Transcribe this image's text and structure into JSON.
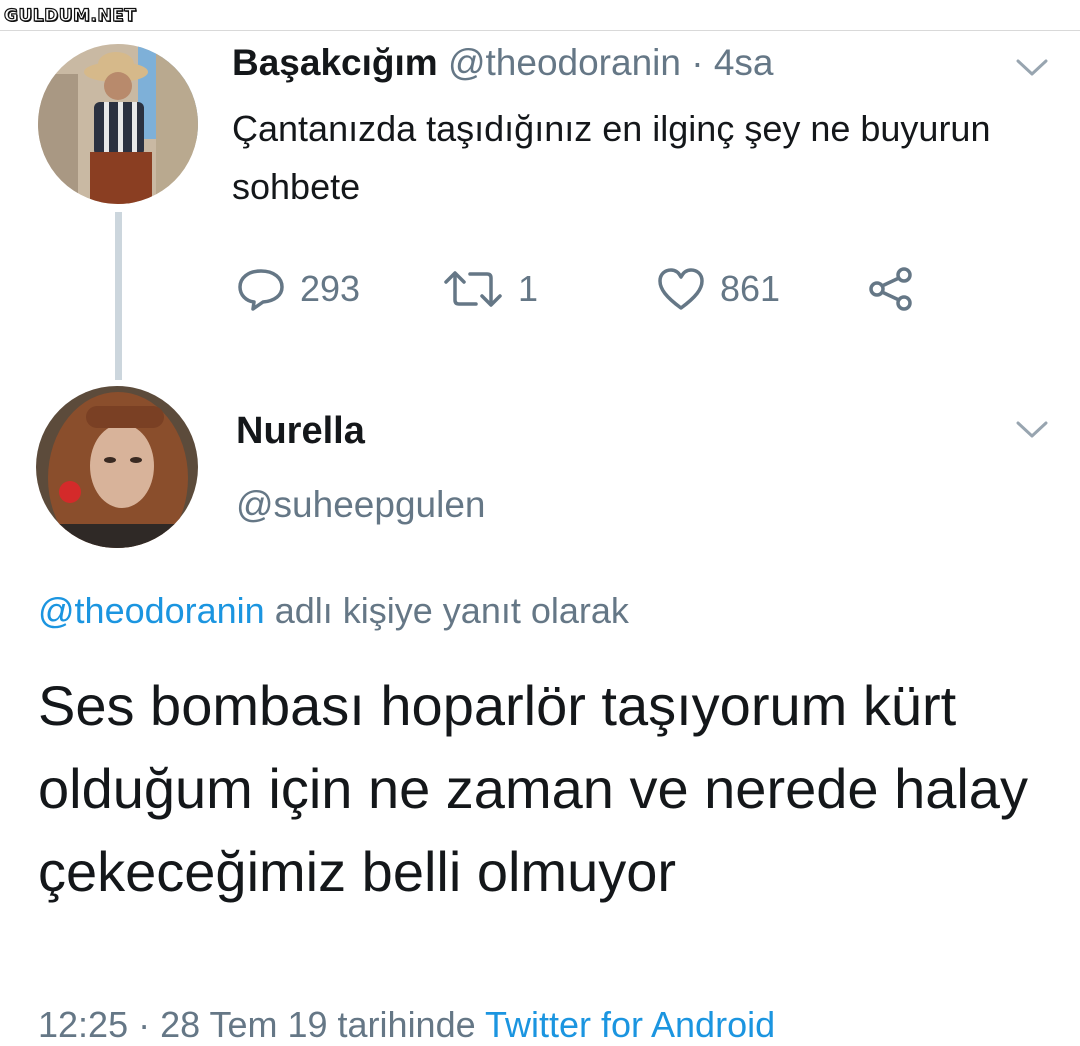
{
  "watermark": "GULDUM.NET",
  "tweet1": {
    "name": "Başakcığım",
    "handle": "@theodoranin",
    "time": "· 4sa",
    "text": "Çantanızda taşıdığınız en ilginç şey ne buyurun sohbete",
    "actions": {
      "replies": "293",
      "retweets": "1",
      "likes": "861"
    }
  },
  "tweet2": {
    "name": "Nurella",
    "handle": "@suheepgulen",
    "reply_prefix": "@theodoranin",
    "reply_suffix": "adlı kişiye yanıt olarak",
    "text": "Ses bombası hoparlör taşıyorum kürt olduğum için ne zaman ve nerede halay çekeceğimiz belli olmuyor",
    "footer_date": "12:25 · 28 Tem 19 tarihinde",
    "footer_source": "Twitter for Android"
  },
  "icons": {
    "reply": "reply-icon",
    "retweet": "retweet-icon",
    "like": "heart-icon",
    "share": "share-icon",
    "menu": "chevron-down-icon"
  },
  "colors": {
    "text": "#14171a",
    "secondary": "#657786",
    "link": "#1b95e0",
    "thread_line": "#ccd6dd"
  }
}
